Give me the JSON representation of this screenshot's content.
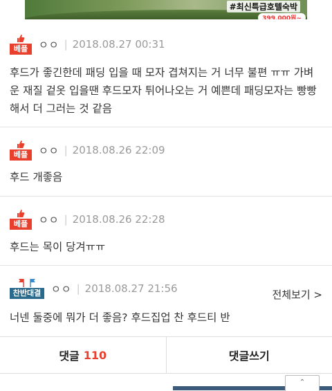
{
  "banner": {
    "tag": "#최신특급호텔숙박",
    "price": "399,000원~"
  },
  "comments": [
    {
      "badge": "베플",
      "author": "ㅇㅇ",
      "separator": "|",
      "date": "2018.08.27 00:31",
      "text": "후드가 좋긴한데 패딩 입을 때 모자 겹쳐지는 거 너무 불편 ㅠㅠ 가벼운 재질 겉옷 입을땐 후드모자 튀어나오는 거 예쁜데 패딩모자는 빵빵해서 더 그러는 것 같음"
    },
    {
      "badge": "베플",
      "author": "ㅇㅇ",
      "separator": "|",
      "date": "2018.08.26 22:09",
      "text": "후드 개좋음"
    },
    {
      "badge": "베플",
      "author": "ㅇㅇ",
      "separator": "|",
      "date": "2018.08.26 22:28",
      "text": "후드는 목이 당겨ㅠㅠ"
    },
    {
      "badge": "찬반대결",
      "author": "ㅇㅇ",
      "separator": "|",
      "date": "2018.08.27 21:56",
      "text": "너넨 둘중에 뭐가 더 좋음? 후드집업 찬 후드티 반",
      "view_all": "전체보기 >"
    }
  ],
  "actions": {
    "comments_label": "댓글",
    "comments_count": "110",
    "write_label": "댓글쓰기"
  },
  "colors": {
    "best_badge": "#e8402c",
    "debate_badge": "#2a6a8c",
    "count": "#e8402c"
  },
  "icons": {
    "best": "thumbs-up-icon",
    "debate": "flags-icon"
  }
}
